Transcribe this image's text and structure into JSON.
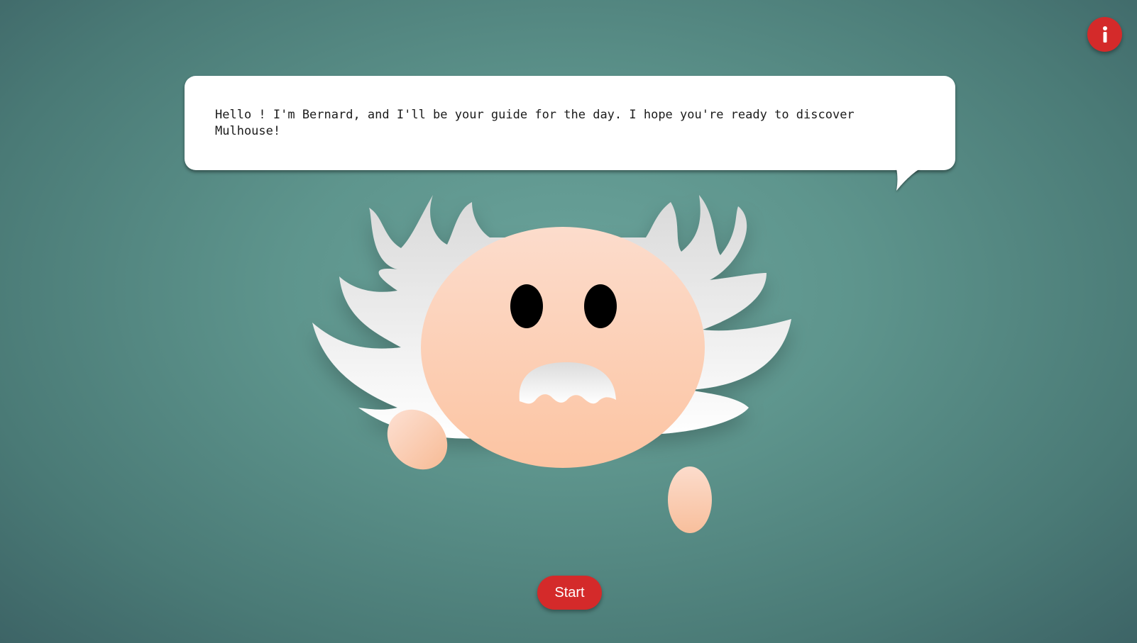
{
  "info_button": {
    "icon": "info-icon",
    "color": "#d42a2a"
  },
  "speech_bubble": {
    "text": "Hello ! I'm Bernard, and I'll be your guide for the day. I hope you're ready to discover Mulhouse!"
  },
  "character": {
    "name": "Bernard",
    "skin_color": "#fcd3bb",
    "hair_color": "#f0f0f0"
  },
  "start_button": {
    "label": "Start",
    "color": "#d42a2a"
  }
}
